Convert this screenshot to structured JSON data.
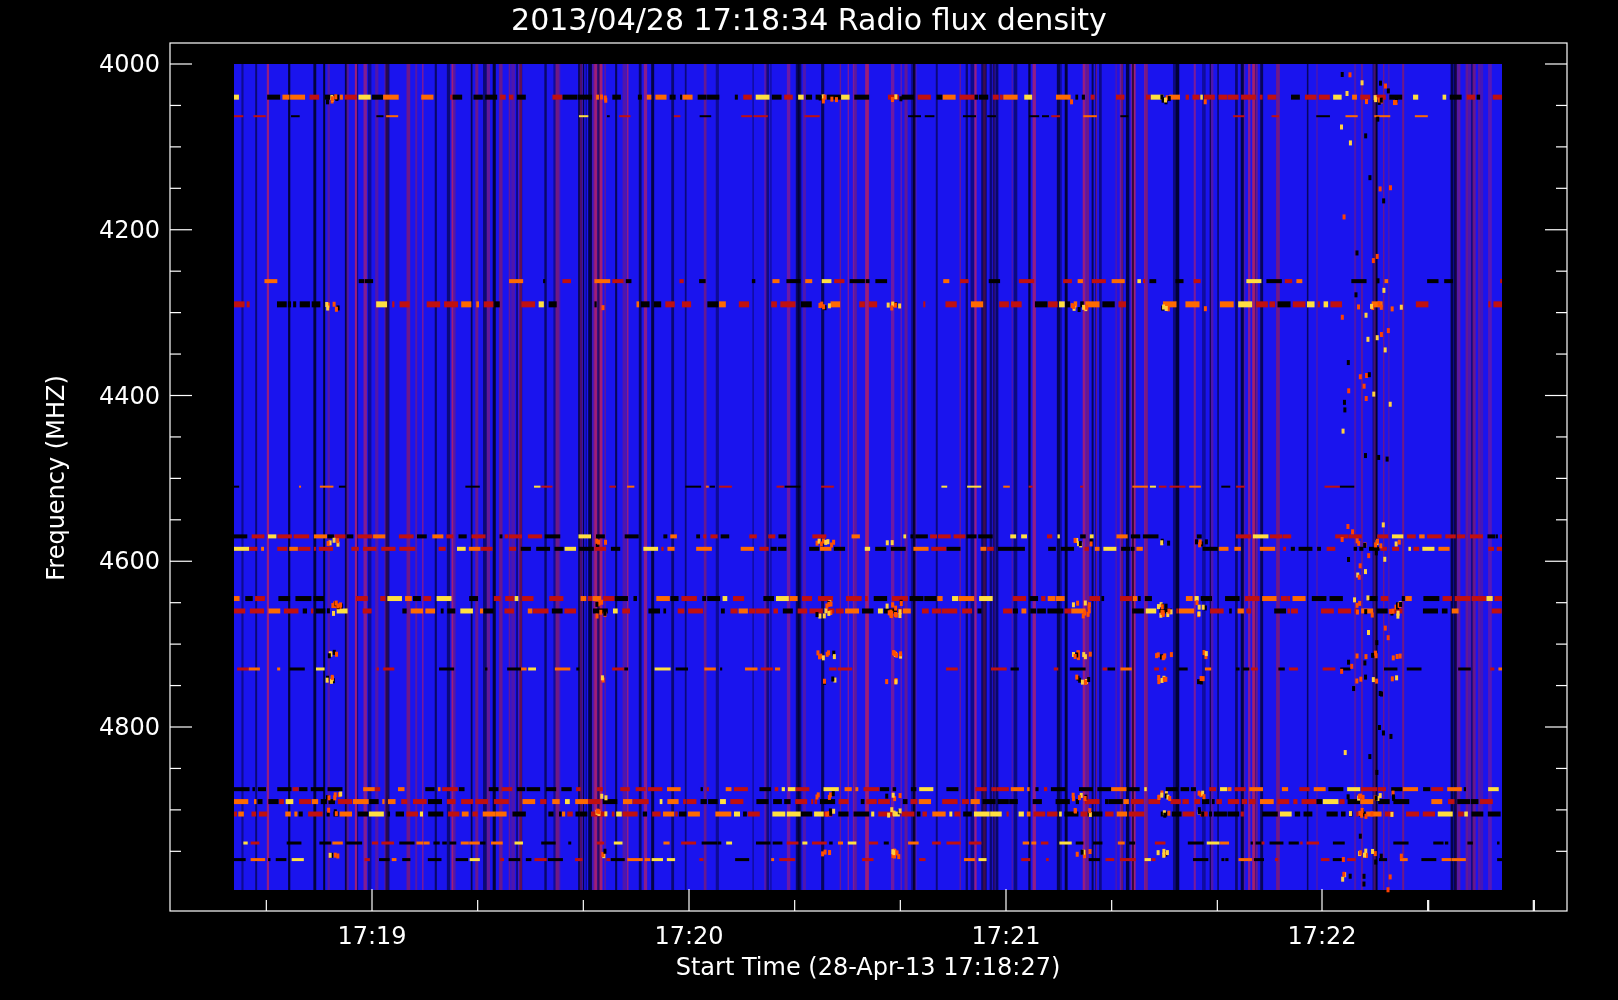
{
  "title": "2013/04/28 17:18:34 Radio flux density",
  "y_axis": {
    "label": "Frequency (MHZ)",
    "ticks": [
      "4000",
      "4200",
      "4400",
      "4600",
      "4800"
    ]
  },
  "x_axis": {
    "label": "Start Time (28-Apr-13 17:18:27)",
    "ticks": [
      "17:19",
      "17:20",
      "17:21",
      "17:22"
    ]
  }
}
